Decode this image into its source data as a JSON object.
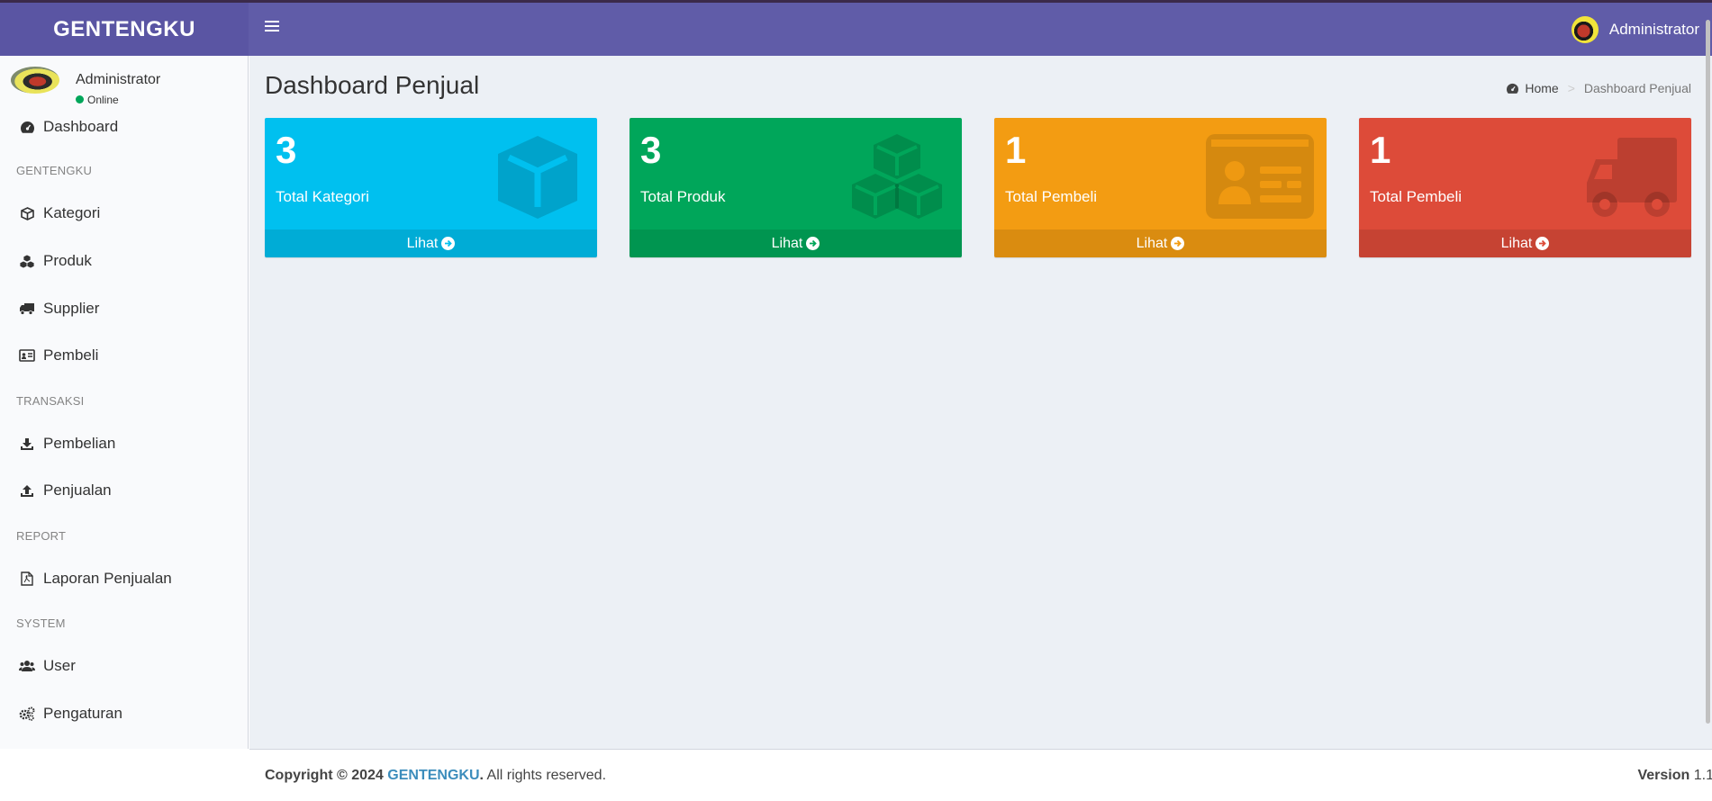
{
  "app": {
    "logo": "GENTENGKU"
  },
  "navbar": {
    "user_name": "Administrator"
  },
  "sidebar": {
    "user": {
      "name": "Administrator",
      "status": "Online"
    },
    "dashboard": "Dashboard",
    "header_gentengku": "GENTENGKU",
    "kategori": "Kategori",
    "produk": "Produk",
    "supplier": "Supplier",
    "pembeli": "Pembeli",
    "header_transaksi": "TRANSAKSI",
    "pembelian": "Pembelian",
    "penjualan": "Penjualan",
    "header_report": "REPORT",
    "laporan": "Laporan Penjualan",
    "header_system": "SYSTEM",
    "user_menu": "User",
    "pengaturan": "Pengaturan"
  },
  "page": {
    "title": "Dashboard Penjual",
    "breadcrumb_home": "Home",
    "breadcrumb_active": "Dashboard Penjual"
  },
  "boxes": [
    {
      "value": "3",
      "label": "Total Kategori",
      "link": "Lihat",
      "color": "#00c0ef",
      "icon": "cube-icon"
    },
    {
      "value": "3",
      "label": "Total Produk",
      "link": "Lihat",
      "color": "#00a65a",
      "icon": "cubes-icon"
    },
    {
      "value": "1",
      "label": "Total Pembeli",
      "link": "Lihat",
      "color": "#f39c12",
      "icon": "id-card-icon"
    },
    {
      "value": "1",
      "label": "Total Pembeli",
      "link": "Lihat",
      "color": "#dd4b39",
      "icon": "truck-icon"
    }
  ],
  "footer": {
    "copyright_prefix": "Copyright © 2024",
    "brand": "GENTENGKU",
    "suffix": ". All rights reserved.",
    "version_label": "Version",
    "version_value": "1.1"
  }
}
